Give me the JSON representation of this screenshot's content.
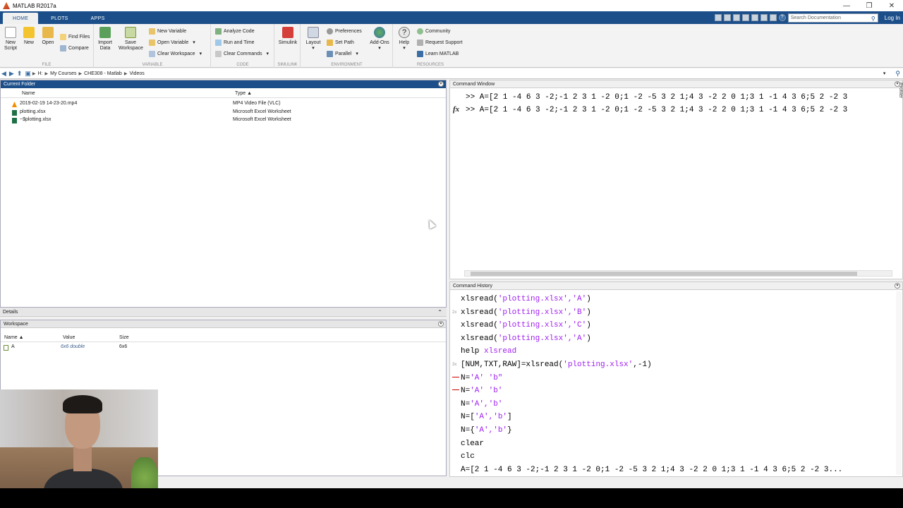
{
  "window": {
    "title": "MATLAB R2017a",
    "controls": [
      "—",
      "❐",
      "✕"
    ]
  },
  "tabs": [
    {
      "label": "HOME",
      "active": true
    },
    {
      "label": "PLOTS",
      "active": false
    },
    {
      "label": "APPS",
      "active": false
    }
  ],
  "quick_access": {
    "search_placeholder": "Search Documentation",
    "login": "Log In"
  },
  "ribbon": {
    "file": {
      "label": "FILE",
      "new_script": "New\nScript",
      "new": "New",
      "open": "Open",
      "find_files": "Find Files",
      "compare": "Compare"
    },
    "variable": {
      "label": "VARIABLE",
      "import_data": "Import\nData",
      "save_workspace": "Save\nWorkspace",
      "new_variable": "New Variable",
      "open_variable": "Open Variable",
      "clear_workspace": "Clear Workspace"
    },
    "code": {
      "label": "CODE",
      "analyze_code": "Analyze Code",
      "run_and_time": "Run and Time",
      "clear_commands": "Clear Commands"
    },
    "simulink": {
      "label": "SIMULINK",
      "simulink": "Simulink"
    },
    "environment": {
      "label": "ENVIRONMENT",
      "layout": "Layout",
      "preferences": "Preferences",
      "set_path": "Set Path",
      "parallel": "Parallel",
      "addons": "Add-Ons"
    },
    "resources": {
      "label": "RESOURCES",
      "help": "Help",
      "community": "Community",
      "request_support": "Request Support",
      "learn_matlab": "Learn MATLAB"
    }
  },
  "address": {
    "crumbs": [
      "H:",
      "My Courses",
      "CHE308 - Matlab",
      "Videos"
    ]
  },
  "current_folder": {
    "title": "Current Folder",
    "columns": {
      "name": "Name",
      "type": "Type ▲"
    },
    "files": [
      {
        "name": "2019-02-19 14-23-20.mp4",
        "type": "MP4 Video File (VLC)",
        "icon": "vlc-icon"
      },
      {
        "name": "plotting.xlsx",
        "type": "Microsoft Excel Worksheet",
        "icon": "excel-icon"
      },
      {
        "name": "~$plotting.xlsx",
        "type": "Microsoft Excel Worksheet",
        "icon": "excel-icon"
      }
    ]
  },
  "details": {
    "title": "Details"
  },
  "workspace": {
    "title": "Workspace",
    "columns": {
      "name": "Name ▲",
      "value": "Value",
      "size": "Size"
    },
    "vars": [
      {
        "name": "A",
        "value": "6x6 double",
        "size": "6x6"
      }
    ]
  },
  "command_window": {
    "title": "Command Window",
    "lines": [
      ">> A=[2 1 -4 6 3 -2;-1 2 3 1 -2 0;1 -2 -5 3 2 1;4 3 -2 2 0 1;3 1 -1 4 3 6;5 2 -2 3",
      ">> A=[2 1 -4 6 3 -2;-1 2 3 1 -2 0;1 -2 -5 3 2 1;4 3 -2 2 0 1;3 1 -1 4 3 6;5 2 -2 3"
    ],
    "prompt_symbol": "fx"
  },
  "command_history": {
    "title": "Command History",
    "entries": [
      {
        "marker": "",
        "pre": "xlsread(",
        "str": "'plotting.xlsx','A'",
        "post": ")"
      },
      {
        "marker": "2x",
        "pre": "xlsread(",
        "str": "'plotting.xlsx','B'",
        "post": ")"
      },
      {
        "marker": "",
        "pre": "xlsread(",
        "str": "'plotting.xlsx','C'",
        "post": ")"
      },
      {
        "marker": "",
        "pre": "xlsread(",
        "str": "'plotting.xlsx','A'",
        "post": ")"
      },
      {
        "marker": "",
        "pre": "help ",
        "str": "xlsread",
        "post": ""
      },
      {
        "marker": "3x",
        "pre": "[NUM,TXT,RAW]=xlsread(",
        "str": "'plotting.xlsx'",
        "post": ",-1)"
      },
      {
        "marker": "err",
        "pre": "N=",
        "str": "'A' 'b\"",
        "post": ""
      },
      {
        "marker": "err",
        "pre": "N=",
        "str": "'A' 'b'",
        "post": ""
      },
      {
        "marker": "",
        "pre": "N=",
        "str": "'A','b'",
        "post": ""
      },
      {
        "marker": "",
        "pre": "N=[",
        "str": "'A','b'",
        "post": "]"
      },
      {
        "marker": "",
        "pre": "N={",
        "str": "'A','b'",
        "post": "}"
      },
      {
        "marker": "",
        "pre": "clear",
        "str": "",
        "post": ""
      },
      {
        "marker": "",
        "pre": "clc",
        "str": "",
        "post": ""
      },
      {
        "marker": "",
        "pre": "A=[2 1 -4 6 3 -2;-1 2 3 1 -2 0;1 -2 -5 3 2 1;4 3 -2 2 0 1;3 1 -1 4 3 6;5 2 -2 3...",
        "str": "",
        "post": ""
      }
    ]
  },
  "side_tab": {
    "label": "Profiler"
  }
}
